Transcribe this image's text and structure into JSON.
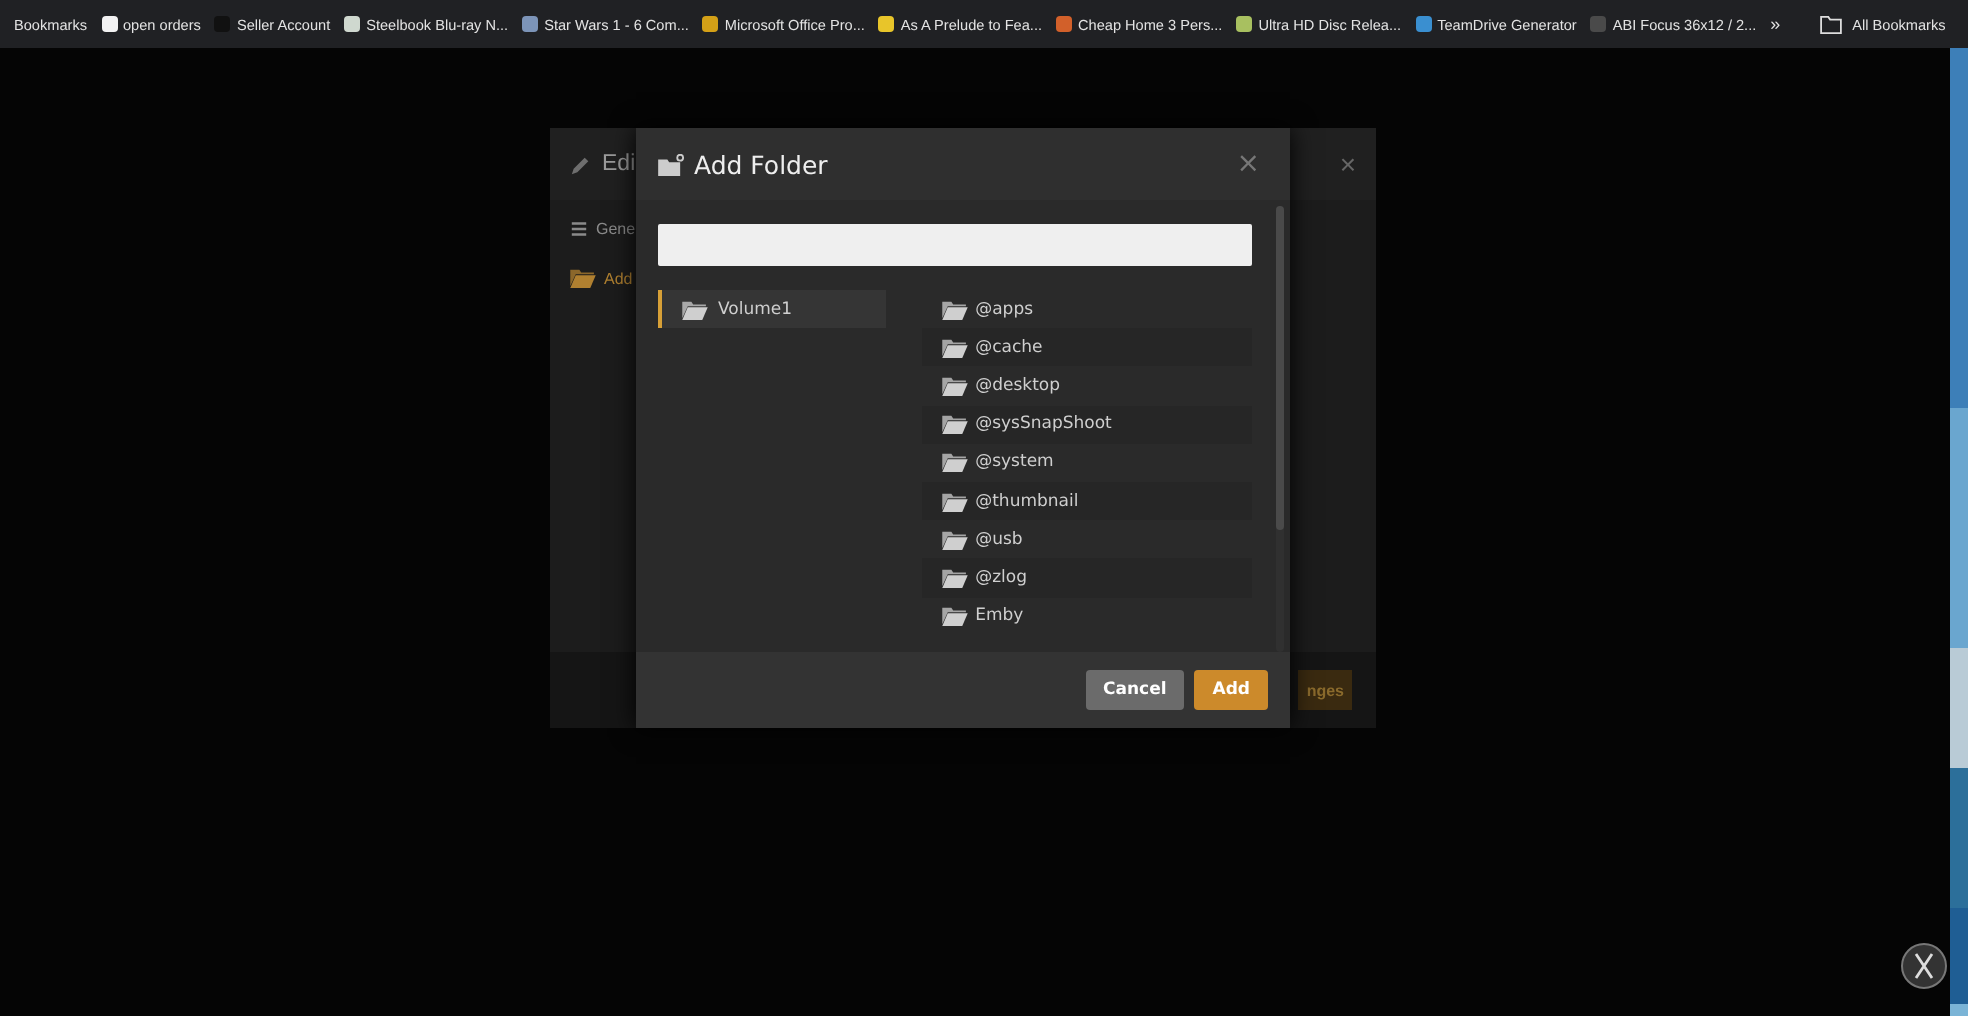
{
  "bookmarks_bar": {
    "items": [
      {
        "label": "Bookmarks",
        "kind": "text"
      },
      {
        "label": "open orders",
        "kind": "site",
        "color": "#f2f2f2"
      },
      {
        "label": "Seller Account",
        "kind": "site",
        "color": "#111111"
      },
      {
        "label": "Steelbook Blu-ray N...",
        "kind": "site",
        "color": "#cfd8cf"
      },
      {
        "label": "Star Wars 1 - 6 Com...",
        "kind": "site",
        "color": "#7c94b8"
      },
      {
        "label": "Microsoft Office Pro...",
        "kind": "site",
        "color": "#d4a017"
      },
      {
        "label": "As A Prelude to Fea...",
        "kind": "site",
        "color": "#e8c52a"
      },
      {
        "label": "Cheap Home 3 Pers...",
        "kind": "site",
        "color": "#d2602a"
      },
      {
        "label": "Ultra HD Disc Relea...",
        "kind": "site",
        "color": "#a8c060"
      },
      {
        "label": "TeamDrive Generator",
        "kind": "site",
        "color": "#3a8fd0"
      },
      {
        "label": "ABI Focus 36x12 / 2...",
        "kind": "site",
        "color": "#4a4a4a"
      }
    ],
    "overflow": "»",
    "all_bookmarks": "All Bookmarks"
  },
  "background_dialog": {
    "title": "Edi",
    "close": "×",
    "nav": [
      {
        "label": "Gene",
        "selected": false
      },
      {
        "label": "Add",
        "selected": true
      }
    ],
    "button": "nges"
  },
  "dialog": {
    "title": "Add Folder",
    "close": "×",
    "volumes": [
      {
        "label": "Volume1",
        "selected": true
      }
    ],
    "folders": [
      {
        "label": "@apps"
      },
      {
        "label": "@cache"
      },
      {
        "label": "@desktop"
      },
      {
        "label": "@sysSnapShoot"
      },
      {
        "label": "@system"
      },
      {
        "label": "@thumbnail"
      },
      {
        "label": "@usb"
      },
      {
        "label": "@zlog"
      },
      {
        "label": "Emby"
      }
    ],
    "buttons": [
      {
        "label": "Cancel",
        "kind": "secondary"
      },
      {
        "label": "Add",
        "kind": "primary"
      }
    ]
  }
}
